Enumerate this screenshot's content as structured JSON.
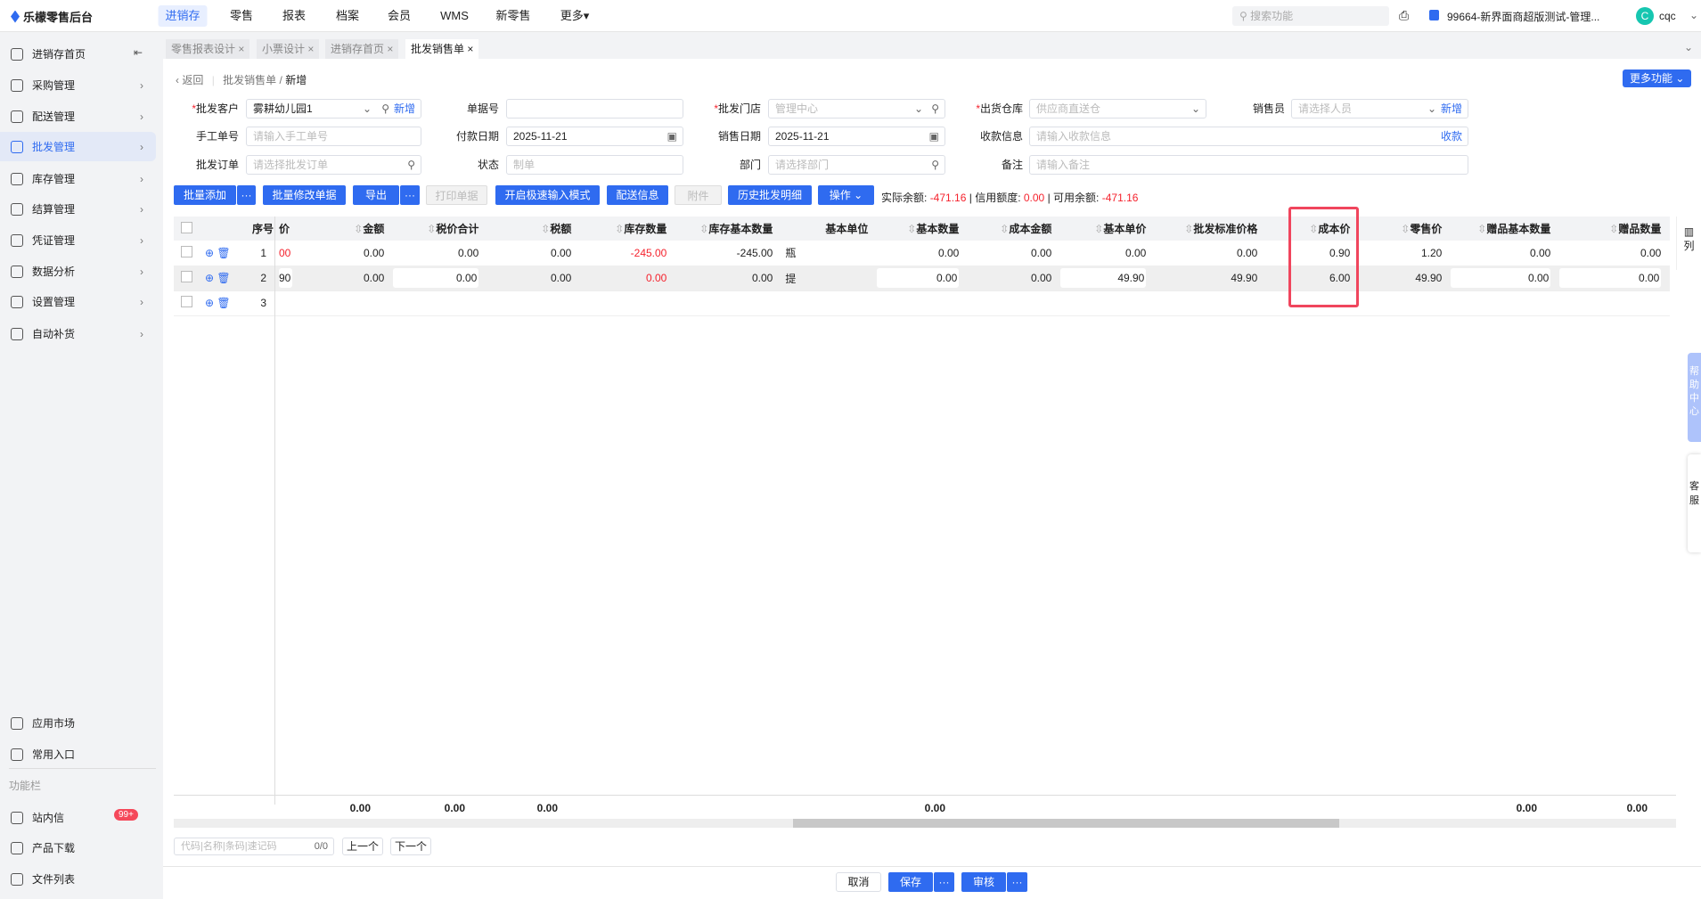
{
  "app": {
    "title": "乐檬零售后台",
    "nav": [
      "进销存",
      "零售",
      "报表",
      "档案",
      "会员",
      "WMS",
      "新零售",
      "更多"
    ],
    "search_placeholder": "搜索功能",
    "store": "99664-新界面商超版测试-管理...",
    "user_initial": "C",
    "user": "cqc"
  },
  "sidebar": {
    "items": [
      "进销存首页",
      "采购管理",
      "配送管理",
      "批发管理",
      "库存管理",
      "结算管理",
      "凭证管理",
      "数据分析",
      "设置管理",
      "自动补货"
    ],
    "bottom": [
      "应用市场",
      "常用入口"
    ],
    "section": "功能栏",
    "tools": [
      "站内信",
      "产品下载",
      "文件列表"
    ],
    "badge": "99+"
  },
  "tabs": [
    "零售报表设计",
    "小票设计",
    "进销存首页",
    "批发销售单"
  ],
  "breadcrumb": {
    "back": "返回",
    "parent": "批发销售单",
    "current": "新增"
  },
  "more_btn": "更多功能",
  "form": {
    "customer": {
      "label": "批发客户",
      "value": "雾耕幼儿园1",
      "add": "新增"
    },
    "doc_no": {
      "label": "单据号",
      "value": ""
    },
    "store": {
      "label": "批发门店",
      "value": "管理中心"
    },
    "warehouse": {
      "label": "出货仓库",
      "value": "供应商直送仓"
    },
    "salesman": {
      "label": "销售员",
      "placeholder": "请选择人员",
      "add": "新增"
    },
    "manual_no": {
      "label": "手工单号",
      "placeholder": "请输入手工单号"
    },
    "pay_date": {
      "label": "付款日期",
      "value": "2025-11-21"
    },
    "sale_date": {
      "label": "销售日期",
      "value": "2025-11-21"
    },
    "receipt": {
      "label": "收款信息",
      "placeholder": "请输入收款信息",
      "action": "收款"
    },
    "order": {
      "label": "批发订单",
      "placeholder": "请选择批发订单"
    },
    "status": {
      "label": "状态",
      "value": "制单"
    },
    "dept": {
      "label": "部门",
      "placeholder": "请选择部门"
    },
    "remark": {
      "label": "备注",
      "placeholder": "请输入备注"
    }
  },
  "toolbar": {
    "batch_add": "批量添加",
    "batch_edit": "批量修改单据",
    "export": "导出",
    "print": "打印单据",
    "fast_input": "开启极速输入模式",
    "delivery": "配送信息",
    "attach": "附件",
    "history": "历史批发明细",
    "ops": "操作",
    "more": "···"
  },
  "balance": {
    "actual_label": "实际余额:",
    "actual": "-471.16",
    "credit_label": "信用额度:",
    "credit": "0.00",
    "avail_label": "可用余额:",
    "avail": "-471.16"
  },
  "table": {
    "seq_header": "序号",
    "columns": [
      "价",
      "金额",
      "税价合计",
      "税额",
      "库存数量",
      "库存基本数量",
      "基本单位",
      "基本数量",
      "成本金额",
      "基本单价",
      "批发标准价格",
      "成本价",
      "零售价",
      "赠品基本数量",
      "赠品数量"
    ],
    "rows": [
      {
        "seq": "1",
        "cells": [
          "00",
          "0.00",
          "0.00",
          "0.00",
          "-245.00",
          "-245.00",
          "瓶",
          "0.00",
          "0.00",
          "0.00",
          "0.00",
          "0.90",
          "1.20",
          "0.00",
          "0.00"
        ]
      },
      {
        "seq": "2",
        "cells": [
          "90",
          "0.00",
          "0.00",
          "0.00",
          "0.00",
          "0.00",
          "提",
          "0.00",
          "0.00",
          "49.90",
          "49.90",
          "6.00",
          "49.90",
          "0.00",
          "0.00"
        ]
      },
      {
        "seq": "3",
        "cells": []
      }
    ],
    "totals": [
      "",
      "0.00",
      "0.00",
      "0.00",
      "",
      "",
      "",
      "0.00",
      "",
      "",
      "",
      "",
      "",
      "0.00",
      "0.00"
    ],
    "col_setting": "列"
  },
  "finder": {
    "placeholder": "代码|名称|条码|速记码",
    "count": "0/0",
    "prev": "上一个",
    "next": "下一个"
  },
  "footer": {
    "cancel": "取消",
    "save": "保存",
    "audit": "审核"
  },
  "float": {
    "help": "帮助中心",
    "service": "客服"
  },
  "colors": {
    "accent": "#2f6bf0",
    "negative": "#f5222d",
    "highlight": "#f0455d"
  }
}
